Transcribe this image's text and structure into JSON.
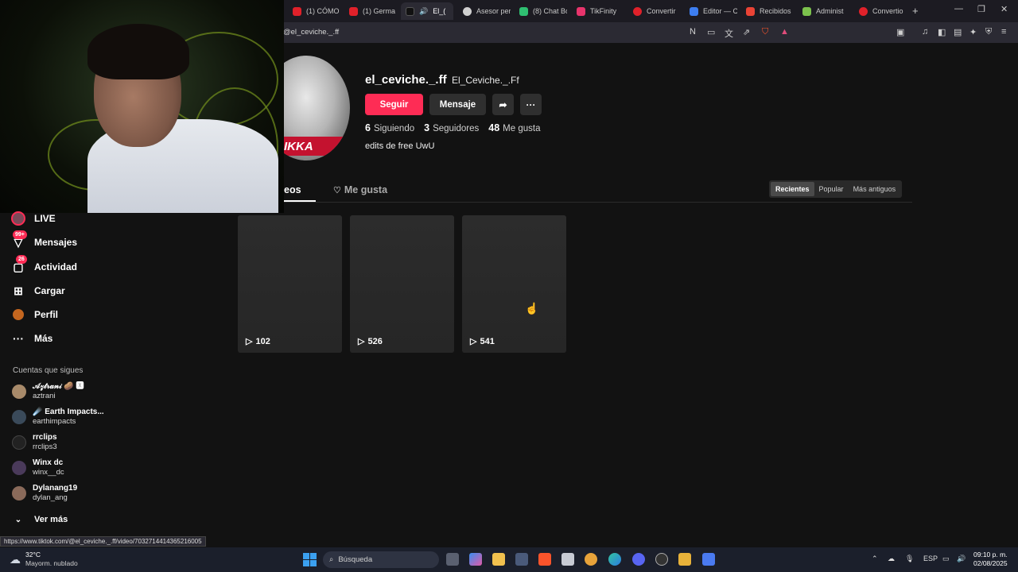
{
  "browser": {
    "tabs": [
      {
        "label": "(1) CÓMO",
        "color": "#e0212a"
      },
      {
        "label": "(1) Germa",
        "color": "#e0212a"
      },
      {
        "label": "El_(",
        "color": "#111111"
      },
      {
        "label": "Asesor per",
        "color": "#d0d0d0"
      },
      {
        "label": "(8) Chat Bo",
        "color": "#2fbf71"
      },
      {
        "label": "TikFinity",
        "color": "#e8346c"
      },
      {
        "label": "Convertir",
        "color": "#e0212a"
      },
      {
        "label": "Editor — C",
        "color": "#3d7ef0"
      },
      {
        "label": "Recibidos",
        "color": "#ea4335"
      },
      {
        "label": "Administ",
        "color": "#7cc24d"
      },
      {
        "label": "Convertio",
        "color": "#e0212a"
      }
    ],
    "new_tab": "+",
    "url": "@el_ceviche._.ff"
  },
  "sidebar": {
    "items": [
      {
        "label": "LIVE",
        "icon": "live-icon",
        "badge": ""
      },
      {
        "label": "Mensajes",
        "icon": "messages-icon",
        "badge": "99+"
      },
      {
        "label": "Actividad",
        "icon": "activity-icon",
        "badge": "26"
      },
      {
        "label": "Cargar",
        "icon": "upload-icon",
        "badge": ""
      },
      {
        "label": "Perfil",
        "icon": "profile-icon",
        "badge": ""
      },
      {
        "label": "Más",
        "icon": "more-icon",
        "badge": ""
      }
    ],
    "following_title": "Cuentas que sigues",
    "following": [
      {
        "name": "𝒜𝓏𝓉𝓇𝒶𝓃𝒾 🥔 🆇",
        "handle": "aztrani",
        "color": "#a88a6a"
      },
      {
        "name": "☄️ Earth Impacts...",
        "handle": "earthimpacts",
        "color": "#3a4a5a"
      },
      {
        "name": "rrclips",
        "handle": "rrclips3",
        "color": "#222222"
      },
      {
        "name": "Winx dc",
        "handle": "winx__dc",
        "color": "#4a3a5a"
      },
      {
        "name": "Dylanang19",
        "handle": "dylan_ang",
        "color": "#8a6a5a"
      }
    ],
    "see_more": "Ver más"
  },
  "profile": {
    "username": "el_ceviche._.ff",
    "nickname": "El_Ceviche._.Ff",
    "avatar_text": "IKKA",
    "follow_btn": "Seguir",
    "message_btn": "Mensaje",
    "stats": [
      {
        "value": "6",
        "label": "Siguiendo"
      },
      {
        "value": "3",
        "label": "Seguidores"
      },
      {
        "value": "48",
        "label": "Me gusta"
      }
    ],
    "bio": "edits de free UwU"
  },
  "tabs": {
    "videos": "eos",
    "liked": "Me gusta"
  },
  "sort": [
    "Recientes",
    "Popular",
    "Más antiguos"
  ],
  "videos": [
    {
      "views": "102"
    },
    {
      "views": "526"
    },
    {
      "views": "541"
    }
  ],
  "status_url": "https://www.tiktok.com/@el_ceviche._.ff/video/7032714414365216005",
  "taskbar": {
    "temp": "32°C",
    "weather": "Mayorm. nublado",
    "search": "Búsqueda",
    "lang": "ESP",
    "time": "09:10 p. m.",
    "date": "02/08/2025"
  },
  "colors": {
    "accent": "#fe2c55",
    "background": "#121212"
  }
}
